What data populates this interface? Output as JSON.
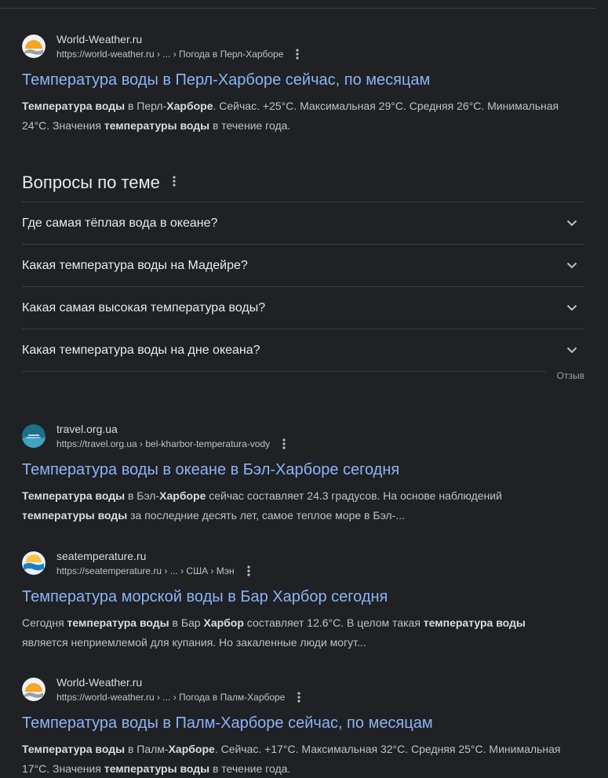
{
  "results": [
    {
      "site": "World-Weather.ru",
      "url": "https://world-weather.ru › ... › Погода в Перл-Харборе",
      "title": "Температура воды в Перл-Харборе сейчас, по месяцам",
      "snippet": [
        {
          "t": "Температура воды",
          "b": true
        },
        {
          "t": " в Перл-",
          "b": false
        },
        {
          "t": "Харборе",
          "b": true
        },
        {
          "t": ". Сейчас. +25°C. Максимальная 29°C. Средняя 26°C. Минимальная 24°C. Значения ",
          "b": false
        },
        {
          "t": "температуры воды",
          "b": true
        },
        {
          "t": " в течение года.",
          "b": false
        }
      ]
    },
    {
      "site": "travel.org.ua",
      "url": "https://travel.org.ua › bel-kharbor-temperatura-vody",
      "title": "Температура воды в океане в Бэл-Харборе сегодня",
      "snippet": [
        {
          "t": "Температура воды",
          "b": true
        },
        {
          "t": " в Бэл-",
          "b": false
        },
        {
          "t": "Харборе",
          "b": true
        },
        {
          "t": " сейчас составляет 24.3 градусов. На основе наблюдений ",
          "b": false
        },
        {
          "t": "температуры воды",
          "b": true
        },
        {
          "t": " за последние десять лет, самое теплое море в Бэл-...",
          "b": false
        }
      ]
    },
    {
      "site": "seatemperature.ru",
      "url": "https://seatemperature.ru › ... › США › Мэн",
      "title": "Температура морской воды в Бар Харбор сегодня",
      "snippet": [
        {
          "t": "Сегодня ",
          "b": false
        },
        {
          "t": "температура воды",
          "b": true
        },
        {
          "t": " в Бар ",
          "b": false
        },
        {
          "t": "Харбор",
          "b": true
        },
        {
          "t": " составляет 12.6°C. В целом такая ",
          "b": false
        },
        {
          "t": "температура воды",
          "b": true
        },
        {
          "t": " является неприемлемой для купания. Но закаленные люди могут...",
          "b": false
        }
      ]
    },
    {
      "site": "World-Weather.ru",
      "url": "https://world-weather.ru › ... › Погода в Палм-Харборе",
      "title": "Температура воды в Палм-Харборе сейчас, по месяцам",
      "snippet": [
        {
          "t": "Температура воды",
          "b": true
        },
        {
          "t": " в Палм-",
          "b": false
        },
        {
          "t": "Харборе",
          "b": true
        },
        {
          "t": ". Сейчас. +17°C. Максимальная 32°C. Средняя 25°C. Минимальная 17°C. Значения ",
          "b": false
        },
        {
          "t": "температуры воды",
          "b": true
        },
        {
          "t": " в течение года.",
          "b": false
        }
      ]
    }
  ],
  "paa": {
    "title": "Вопросы по теме",
    "questions": [
      "Где самая тёплая вода в океане?",
      "Какая температура воды на Мадейре?",
      "Какая самая высокая температура воды?",
      "Какая температура воды на дне океана?"
    ],
    "feedback": "Отзыв"
  },
  "colors": {
    "background": "#202124",
    "link": "#8ab4f8",
    "text": "#bdc1c6"
  },
  "icons": [
    "world-weather-favicon-icon",
    "travel-favicon-icon",
    "seatemperature-favicon-icon",
    "more-vert-icon",
    "chevron-down-icon"
  ]
}
